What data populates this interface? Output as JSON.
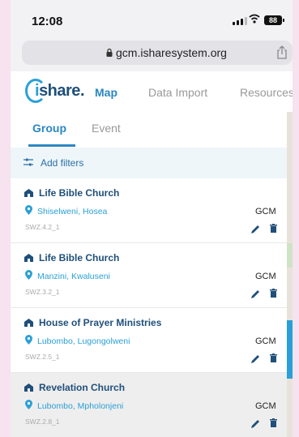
{
  "status_bar": {
    "time": "12:08",
    "battery": "88"
  },
  "browser": {
    "url": "gcm.isharesystem.org"
  },
  "app": {
    "logo": {
      "text_i": "(",
      "text_rest": "share"
    },
    "nav": {
      "map": "Map",
      "data_import": "Data Import",
      "resources": "Resources"
    },
    "tabs": {
      "group": "Group",
      "event": "Event"
    },
    "filters": {
      "label": "Add filters"
    },
    "colors": {
      "accent": "#2a87c2",
      "brand_dark": "#1f4f7a",
      "link": "#2aa0d6"
    }
  },
  "groups": [
    {
      "name": "Life Bible Church",
      "location": "Shiselweni, Hosea",
      "org": "GCM",
      "code": "SWZ.4.2_1"
    },
    {
      "name": "Life Bible Church",
      "location": "Manzini, Kwaluseni",
      "org": "GCM",
      "code": "SWZ.3.2_1"
    },
    {
      "name": "House of Prayer Ministries",
      "location": "Lubombo, Lugongolweni",
      "org": "GCM",
      "code": "SWZ.2.5_1"
    },
    {
      "name": "Revelation Church",
      "location": "Lubombo, Mpholonjeni",
      "org": "GCM",
      "code": "SWZ.2.8_1"
    }
  ]
}
